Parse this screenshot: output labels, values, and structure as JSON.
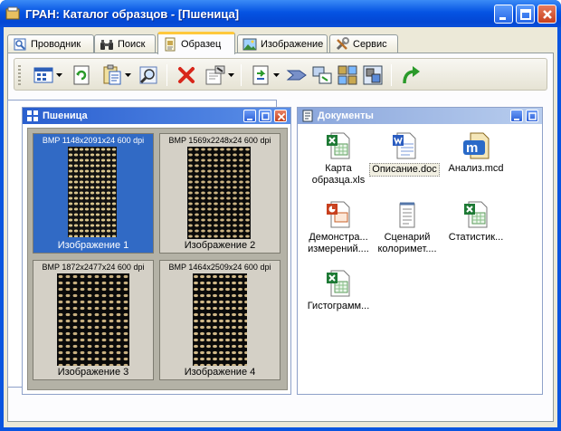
{
  "window": {
    "title": "ГРАН: Каталог образцов - [Пшеница]"
  },
  "tabs": [
    {
      "label": "Проводник",
      "icon": "explorer-icon"
    },
    {
      "label": "Поиск",
      "icon": "binoculars-icon"
    },
    {
      "label": "Образец",
      "icon": "sample-icon",
      "active": true
    },
    {
      "label": "Изображение",
      "icon": "picture-icon"
    },
    {
      "label": "Сервис",
      "icon": "tools-icon"
    }
  ],
  "toolbar": {
    "buttons": [
      "view-mode-icon",
      "refresh-icon",
      "paste-icon",
      "zoom-icon",
      "delete-icon",
      "properties-icon",
      "export-icon",
      "process-icon",
      "arrange-icon",
      "compare-icon",
      "grid-icon",
      "forward-icon"
    ]
  },
  "left_pane": {
    "title": "Пшеница",
    "thumbnails": [
      {
        "info": "BMP 1148x2091x24 600 dpi",
        "caption": "Изображение 1",
        "selected": true
      },
      {
        "info": "BMP 1569x2248x24 600 dpi",
        "caption": "Изображение 2",
        "selected": false
      },
      {
        "info": "BMP 1872x2477x24 600 dpi",
        "caption": "Изображение 3",
        "selected": false
      },
      {
        "info": "BMP 1464x2509x24 600 dpi",
        "caption": "Изображение 4",
        "selected": false
      }
    ]
  },
  "right_pane": {
    "title": "Документы",
    "documents": [
      {
        "label1": "Карта",
        "label2": "образца.xls",
        "type": "excel"
      },
      {
        "label1": "Описание.doc",
        "label2": "",
        "type": "word",
        "focus": true
      },
      {
        "label1": "Анализ.mcd",
        "label2": "",
        "type": "mathcad"
      },
      {
        "label1": "Демонстра...",
        "label2": "измерений....",
        "type": "powerpoint"
      },
      {
        "label1": "Сценарий",
        "label2": "колоримет....",
        "type": "text"
      },
      {
        "label1": "Статистик...",
        "label2": "",
        "type": "excel"
      },
      {
        "label1": "Гистограмм...",
        "label2": "",
        "type": "excel"
      }
    ]
  },
  "colors": {
    "titlebar": "#0554e3",
    "selection": "#316ac5",
    "face": "#ece9d8"
  }
}
